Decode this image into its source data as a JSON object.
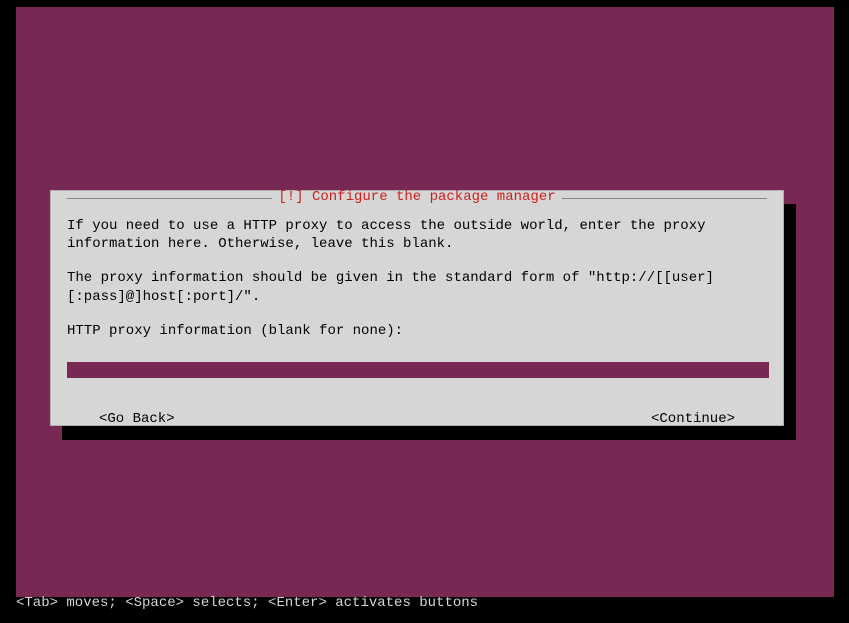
{
  "dialog": {
    "title": "[!] Configure the package manager",
    "para1": "If you need to use a HTTP proxy to access the outside world, enter the proxy information here. Otherwise, leave this blank.",
    "para2": "The proxy information should be given in the standard form of \"http://[[user][:pass]@]host[:port]/\".",
    "prompt": "HTTP proxy information (blank for none):",
    "input_value": "",
    "go_back": "<Go Back>",
    "continue": "<Continue>"
  },
  "help_bar": "<Tab> moves; <Space> selects; <Enter> activates buttons"
}
